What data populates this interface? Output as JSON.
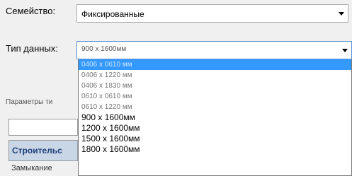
{
  "family": {
    "label": "Семейство:",
    "value": "Фиксированные"
  },
  "type": {
    "label": "Тип данных:",
    "value": "900 x 1600мм"
  },
  "dropdown": {
    "options": [
      "0406 x 0610 мм",
      "0406 x 1220 мм",
      "0406 x 1830 мм",
      "0610 x 0610 мм",
      "0610 x 1220 мм",
      "900 x 1600мм",
      "1200 x 1600мм",
      "1500 x 1600мм",
      "1800 x 1600мм"
    ],
    "selected_index": 0
  },
  "params": {
    "label": "Параметры ти",
    "column_header": "Строительс",
    "row_cell": "Замыкание"
  }
}
